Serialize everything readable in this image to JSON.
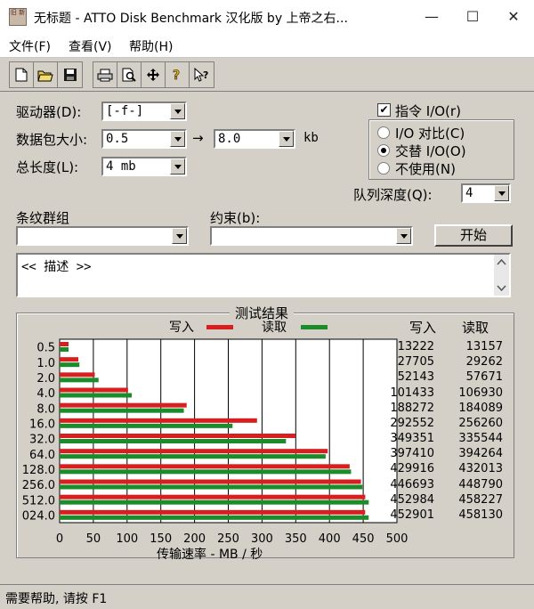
{
  "window": {
    "icon_text": "旧 新",
    "title": "无标题 - ATTO Disk Benchmark 汉化版 by 上帝之右...",
    "minimize": "—",
    "maximize": "☐",
    "close": "✕"
  },
  "menu": [
    "文件(F)",
    "查看(V)",
    "帮助(H)"
  ],
  "toolbar": {
    "icons": [
      "new-file-icon",
      "open-folder-icon",
      "save-disk-icon",
      "print-icon",
      "print-preview-icon",
      "move-icon",
      "help-icon",
      "context-help-icon"
    ],
    "glyphs": [
      "🗋",
      "📂",
      "💾",
      "🖶",
      "🔍",
      "✥",
      "?",
      "↖?"
    ]
  },
  "settings": {
    "drive_label": "驱动器(D):",
    "drive_value": "[-f-]",
    "transfer_label": "数据包大小:",
    "transfer_from": "0.5",
    "transfer_arrow": "→",
    "transfer_to": "8.0",
    "transfer_unit": "kb",
    "length_label": "总长度(L):",
    "length_value": "4 mb",
    "direct_io_label": "指令 I/O(r)",
    "direct_io_checked": "✔",
    "io_compare_label": "I/O 对比(C)",
    "overlapped_io_label": "交替 I/O(O)",
    "neither_label": "不使用(N)",
    "queue_depth_label": "队列深度(Q):",
    "queue_depth_value": "4",
    "stripe_label": "条纹群组",
    "stripe_value": "",
    "constraint_label": "约束(b):",
    "constraint_value": "",
    "start_button": "开始",
    "description": "<< 描述 >>"
  },
  "results": {
    "title": "测试结果",
    "legend_write": "写入",
    "legend_read": "读取",
    "col_write": "写入",
    "col_read": "读取",
    "xlabel": "传输速率 - MB / 秒",
    "write_color": "#d81e1e",
    "read_color": "#1a8c2a",
    "rows": [
      {
        "size": "0.5",
        "write": "13222",
        "read": "13157"
      },
      {
        "size": "1.0",
        "write": "27705",
        "read": "29262"
      },
      {
        "size": "2.0",
        "write": "52143",
        "read": "57671"
      },
      {
        "size": "4.0",
        "write": "101433",
        "read": "106930"
      },
      {
        "size": "8.0",
        "write": "188272",
        "read": "184089"
      },
      {
        "size": "16.0",
        "write": "292552",
        "read": "256260"
      },
      {
        "size": "32.0",
        "write": "349351",
        "read": "335544"
      },
      {
        "size": "64.0",
        "write": "397410",
        "read": "394264"
      },
      {
        "size": "128.0",
        "write": "429916",
        "read": "432013"
      },
      {
        "size": "256.0",
        "write": "446693",
        "read": "448790"
      },
      {
        "size": "512.0",
        "write": "452984",
        "read": "458227"
      },
      {
        "size": "024.0",
        "write": "452901",
        "read": "458130"
      }
    ]
  },
  "chart_data": {
    "type": "bar",
    "title": "测试结果",
    "xlabel": "传输速率 - MB / 秒",
    "ylabel": "",
    "categories": [
      "0.5",
      "1.0",
      "2.0",
      "4.0",
      "8.0",
      "16.0",
      "32.0",
      "64.0",
      "128.0",
      "256.0",
      "512.0",
      "024.0"
    ],
    "series": [
      {
        "name": "写入",
        "values": [
          13.2,
          27.7,
          52.1,
          101.4,
          188.3,
          292.6,
          349.4,
          397.4,
          429.9,
          446.7,
          453.0,
          452.9
        ]
      },
      {
        "name": "读取",
        "values": [
          13.2,
          29.3,
          57.7,
          106.9,
          184.1,
          256.3,
          335.5,
          394.3,
          432.0,
          448.8,
          458.2,
          458.1
        ]
      }
    ],
    "xlim": [
      0,
      500
    ],
    "xticks": [
      "0",
      "50",
      "100",
      "150",
      "200",
      "250",
      "300",
      "350",
      "400",
      "450",
      "500"
    ],
    "orientation": "horizontal",
    "grid": true
  },
  "status": "需要帮助, 请按 F1"
}
